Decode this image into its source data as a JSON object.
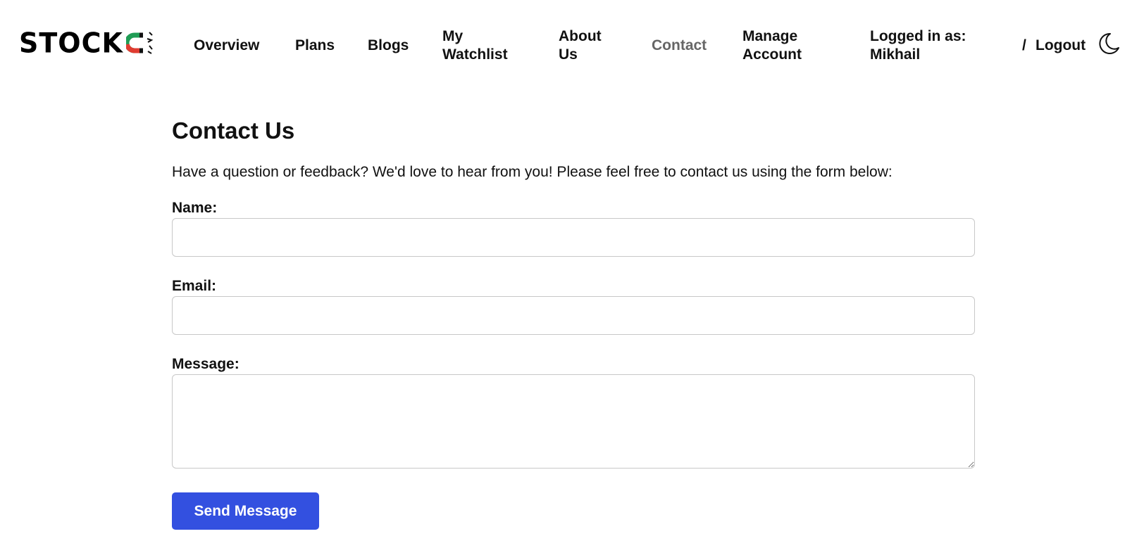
{
  "header": {
    "logo_text": "STOCK",
    "nav": {
      "overview": "Overview",
      "plans": "Plans",
      "blogs": "Blogs",
      "watchlist": "My Watchlist",
      "about": "About Us",
      "contact": "Contact",
      "manage_account": "Manage Account"
    },
    "user_label": "Logged in as: Mikhail",
    "separator": "/",
    "logout": "Logout",
    "theme_icon": "moon-icon",
    "active_color": "#666666"
  },
  "contact": {
    "title": "Contact Us",
    "intro": "Have a question or feedback? We'd love to hear from you! Please feel free to contact us using the form below:",
    "name_label": "Name:",
    "name_value": "",
    "email_label": "Email:",
    "email_value": "",
    "message_label": "Message:",
    "message_value": "",
    "submit_label": "Send Message",
    "submit_color": "#3350e0"
  },
  "brand_colors": {
    "green": "#1f9d55",
    "red": "#e03c31"
  }
}
